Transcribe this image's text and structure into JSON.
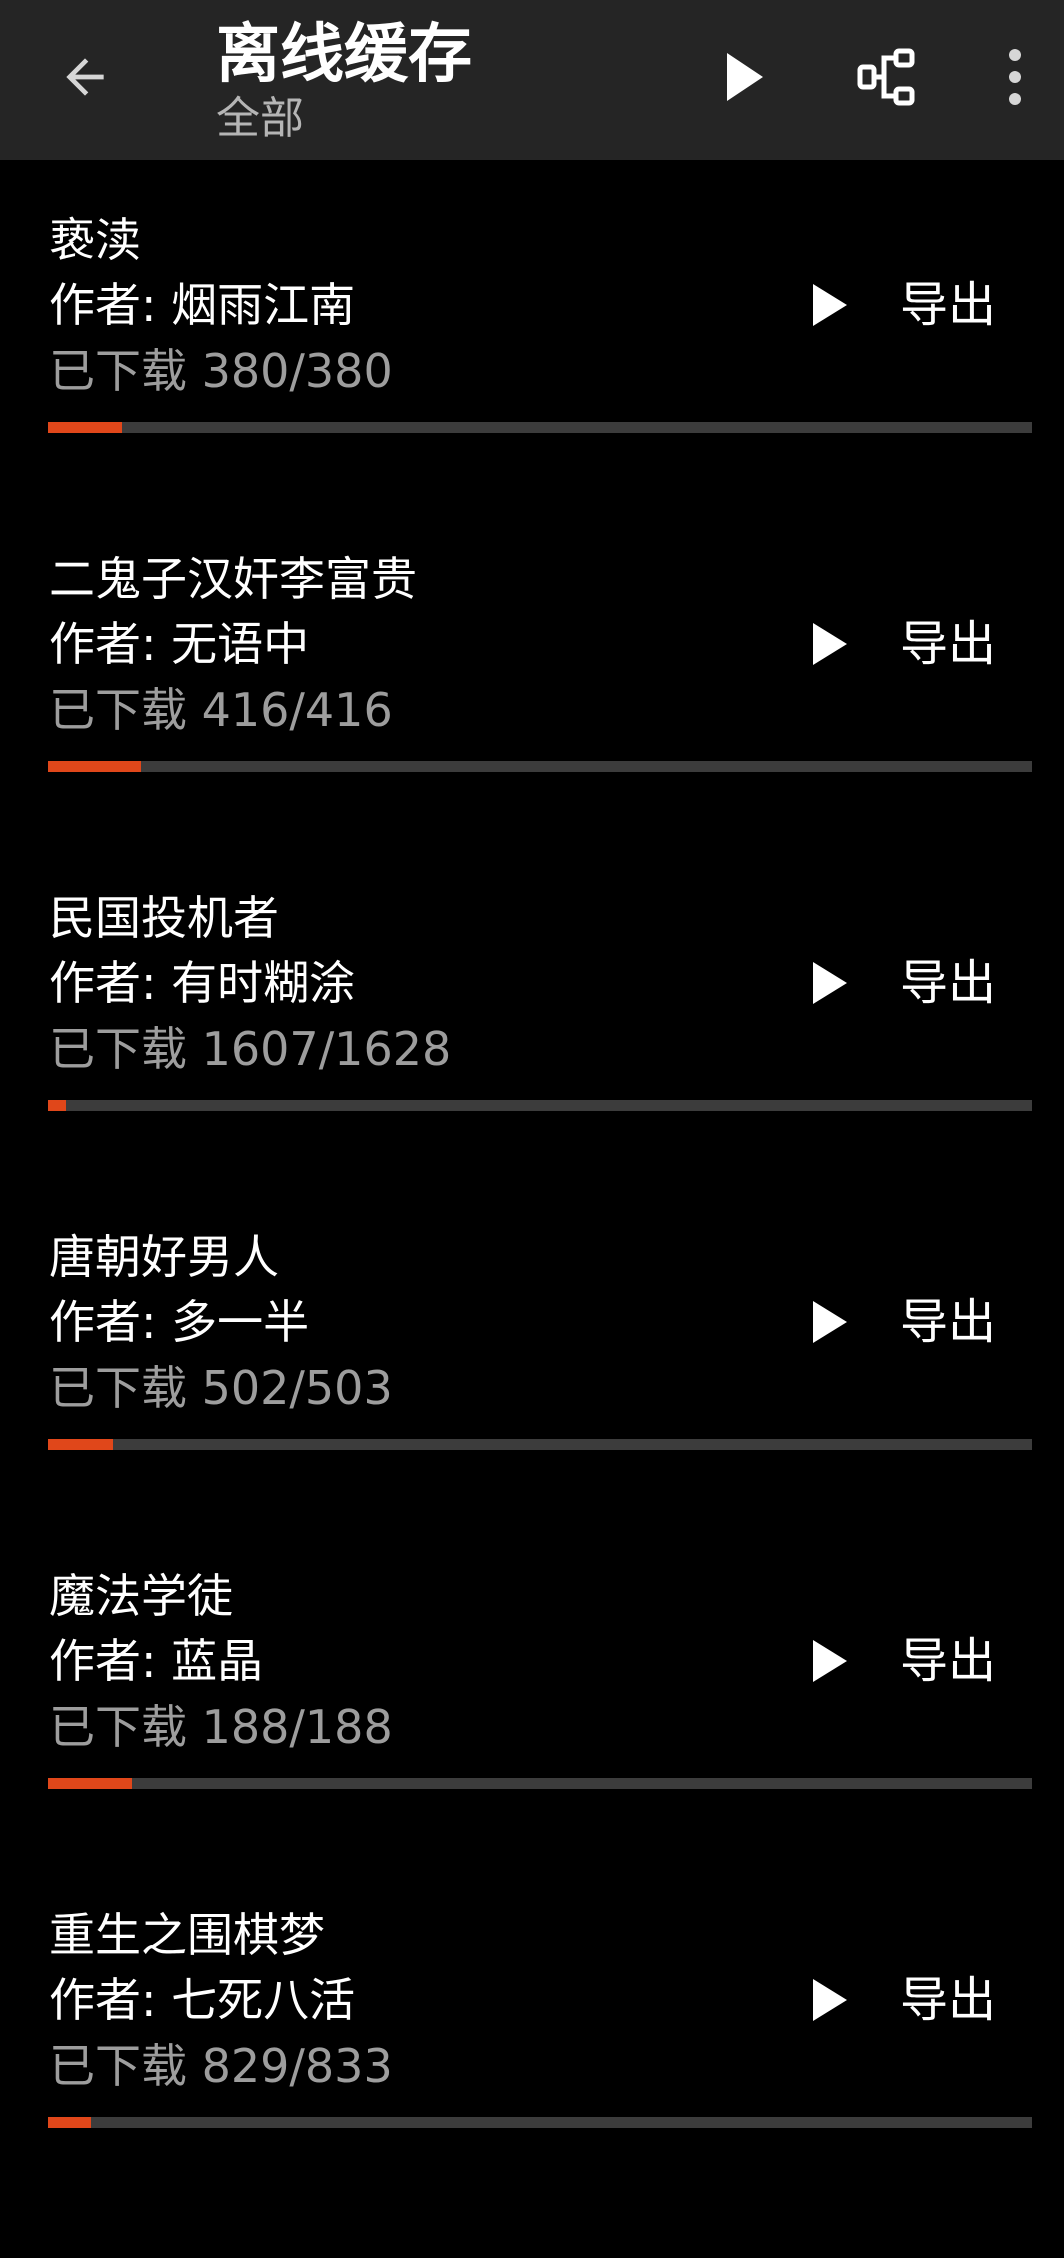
{
  "appbar": {
    "title": "离线缓存",
    "subtitle": "全部",
    "icons": {
      "back": "arrow-left-icon",
      "play": "play-icon",
      "tree": "hierarchy-icon",
      "more": "more-vert-icon"
    }
  },
  "colors": {
    "appbar_bg": "#252525",
    "background": "#000000",
    "progress_fill": "#e0471a",
    "progress_track": "#3c3c3c",
    "secondary_text": "#9d9d9d"
  },
  "items": [
    {
      "title": "亵渎",
      "author": "作者: 烟雨江南",
      "progress_text": "已下载 380/380",
      "export_label": "导出",
      "bar_fill": 0.075
    },
    {
      "title": "二鬼子汉奸李富贵",
      "author": "作者: 无语中",
      "progress_text": "已下载 416/416",
      "export_label": "导出",
      "bar_fill": 0.095
    },
    {
      "title": "民国投机者",
      "author": "作者: 有时糊涂",
      "progress_text": "已下载 1607/1628",
      "export_label": "导出",
      "bar_fill": 0.018
    },
    {
      "title": "唐朝好男人",
      "author": "作者: 多一半",
      "progress_text": "已下载 502/503",
      "export_label": "导出",
      "bar_fill": 0.066
    },
    {
      "title": "魔法学徒",
      "author": "作者: 蓝晶",
      "progress_text": "已下载 188/188",
      "export_label": "导出",
      "bar_fill": 0.085
    },
    {
      "title": "重生之围棋梦",
      "author": "作者: 七死八活",
      "progress_text": "已下载 829/833",
      "export_label": "导出",
      "bar_fill": 0.044
    }
  ]
}
